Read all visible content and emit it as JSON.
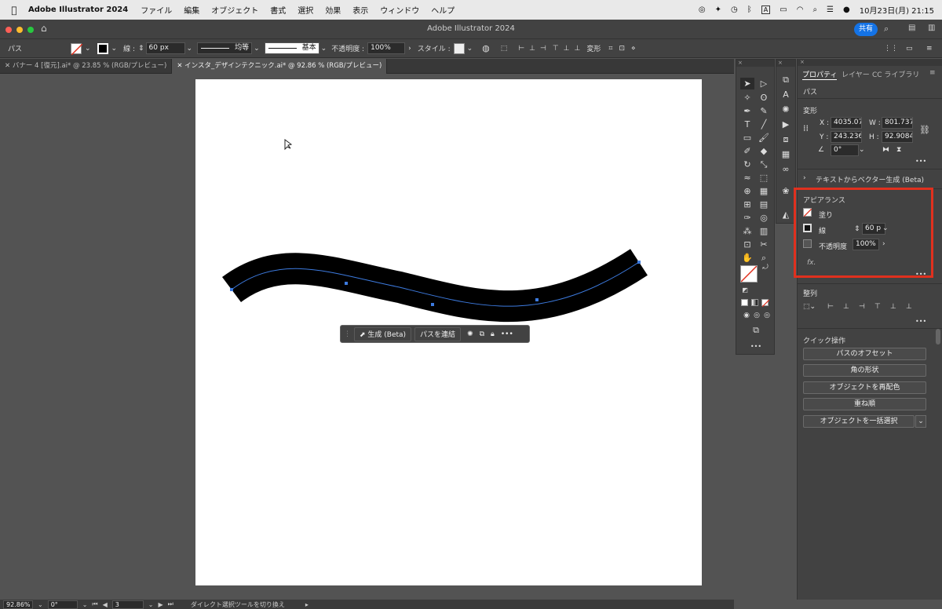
{
  "menubar": {
    "app": "Adobe Illustrator 2024",
    "items": [
      "ファイル",
      "編集",
      "オブジェクト",
      "書式",
      "選択",
      "効果",
      "表示",
      "ウィンドウ",
      "ヘルプ"
    ],
    "datetime": "10月23日(月)  21:15",
    "input_mode": "A"
  },
  "window": {
    "title": "Adobe Illustrator 2024",
    "share": "共有"
  },
  "control": {
    "kind": "パス",
    "stroke_label": "線 :",
    "stroke_weight": "60 px",
    "profile": "均等",
    "brush": "基本",
    "opacity_label": "不透明度 :",
    "opacity": "100%",
    "style_label": "スタイル :",
    "transform": "変形"
  },
  "tabs": [
    {
      "label": "バナー 4 [復元].ai* @ 23.85 % (RGB/プレビュー)",
      "active": false
    },
    {
      "label": "インスタ_デザインテクニック.ai* @ 92.86 % (RGB/プレビュー)",
      "active": true
    }
  ],
  "context": {
    "generate": "生成 (Beta)",
    "join": "パスを連結"
  },
  "status": {
    "zoom": "92.86%",
    "rotation": "0°",
    "artboard": "3",
    "hint": "ダイレクト選択ツールを切り換え"
  },
  "props": {
    "tabs": [
      "プロパティ",
      "レイヤー",
      "CC ライブラリ"
    ],
    "kind": "パス",
    "transform": {
      "title": "変形",
      "x_label": "X :",
      "x": "4035.07",
      "y_label": "Y :",
      "y": "243.236",
      "w_label": "W :",
      "w": "801.737",
      "h_label": "H :",
      "h": "92.9084",
      "angle": "0°"
    },
    "text_to_vector": "テキストからベクター生成 (Beta)",
    "appearance": {
      "title": "アピアランス",
      "fill": "塗り",
      "stroke": "線",
      "stroke_value": "60 p",
      "opacity": "不透明度",
      "opacity_value": "100%",
      "fx": "fx."
    },
    "align": {
      "title": "整列"
    },
    "quick": {
      "title": "クイック操作",
      "buttons": [
        "パスのオフセット",
        "角の形状",
        "オブジェクトを再配色",
        "重ね順",
        "オブジェクトを一括選択"
      ]
    }
  },
  "colors": {
    "accent": "#1473e6",
    "highlight": "#e0301e",
    "path_selection": "#3d7be0"
  }
}
